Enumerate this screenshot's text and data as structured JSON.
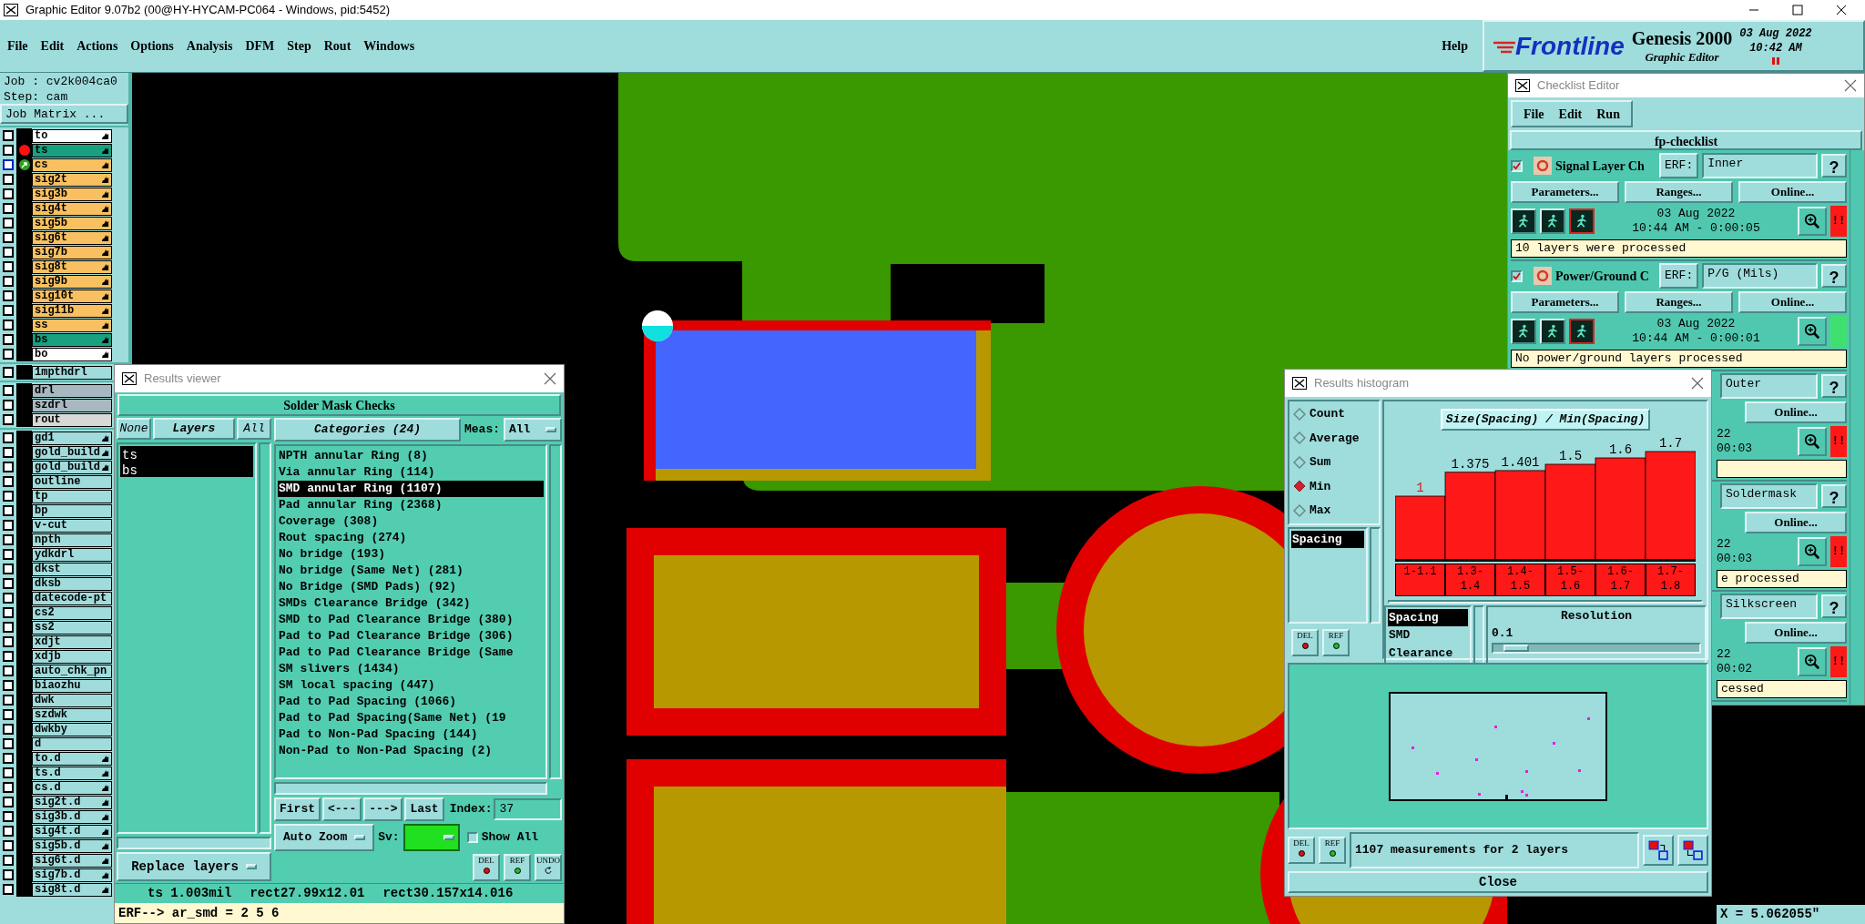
{
  "window": {
    "title": "Graphic Editor 9.07b2 (00@HY-HYCAM-PC064 - Windows, pid:5452)"
  },
  "menu": [
    "File",
    "Edit",
    "Actions",
    "Options",
    "Analysis",
    "DFM",
    "Step",
    "Rout",
    "Windows"
  ],
  "help": "Help",
  "logo": {
    "brand": "Frontline",
    "product": "Genesis 2000",
    "subtitle": "Graphic Editor",
    "date": "03 Aug 2022",
    "time": "10:42 AM"
  },
  "job": {
    "job": "Job : cv2k004ca0",
    "step": "Step: cam",
    "matrix_button": "Job Matrix ..."
  },
  "layer_groups": [
    [
      {
        "name": "to",
        "color": "#ffffff",
        "edit": true,
        "checked": false,
        "active": false,
        "affected": false
      },
      {
        "name": "ts",
        "color": "#18a080",
        "edit": true,
        "checked": false,
        "active": true,
        "affected": false
      },
      {
        "name": "cs",
        "color": "#f8c060",
        "edit": true,
        "checked": false,
        "active": false,
        "affected": true
      },
      {
        "name": "sig2t",
        "color": "#f8c060",
        "edit": true,
        "checked": false,
        "active": false,
        "affected": false
      },
      {
        "name": "sig3b",
        "color": "#f8c060",
        "edit": true,
        "checked": false,
        "active": false,
        "affected": false
      },
      {
        "name": "sig4t",
        "color": "#f8c060",
        "edit": true,
        "checked": false,
        "active": false,
        "affected": false
      },
      {
        "name": "sig5b",
        "color": "#f8c060",
        "edit": true,
        "checked": false,
        "active": false,
        "affected": false
      },
      {
        "name": "sig6t",
        "color": "#f8c060",
        "edit": true,
        "checked": false,
        "active": false,
        "affected": false
      },
      {
        "name": "sig7b",
        "color": "#f8c060",
        "edit": true,
        "checked": false,
        "active": false,
        "affected": false
      },
      {
        "name": "sig8t",
        "color": "#f8c060",
        "edit": true,
        "checked": false,
        "active": false,
        "affected": false
      },
      {
        "name": "sig9b",
        "color": "#f8c060",
        "edit": true,
        "checked": false,
        "active": false,
        "affected": false
      },
      {
        "name": "sig10t",
        "color": "#f8c060",
        "edit": true,
        "checked": false,
        "active": false,
        "affected": false
      },
      {
        "name": "sig11b",
        "color": "#f8c060",
        "edit": true,
        "checked": false,
        "active": false,
        "affected": false
      },
      {
        "name": "ss",
        "color": "#f8c060",
        "edit": true,
        "checked": false,
        "active": false,
        "affected": false
      },
      {
        "name": "bs",
        "color": "#18a080",
        "edit": true,
        "checked": false,
        "active": false,
        "affected": false
      },
      {
        "name": "bo",
        "color": "#ffffff",
        "edit": true,
        "checked": false,
        "active": false,
        "affected": false
      }
    ],
    [
      {
        "name": "1mpthdrl",
        "color": "#a0dcdc",
        "edit": false,
        "checked": false,
        "active": false,
        "affected": false
      }
    ],
    [
      {
        "name": "drl",
        "color": "#a8b8c0",
        "edit": false,
        "checked": false,
        "active": false,
        "affected": false
      },
      {
        "name": "szdrl",
        "color": "#a8b8c0",
        "edit": false,
        "checked": false,
        "active": false,
        "affected": false
      },
      {
        "name": "rout",
        "color": "#d8d8d8",
        "edit": false,
        "checked": false,
        "active": false,
        "affected": false
      }
    ],
    [
      {
        "name": "gd1",
        "color": "#a0dcdc",
        "edit": true,
        "checked": false,
        "active": false,
        "affected": false
      },
      {
        "name": "gold_build",
        "color": "#a0dcdc",
        "edit": true,
        "checked": false,
        "active": false,
        "affected": false
      },
      {
        "name": "gold_build",
        "color": "#a0dcdc",
        "edit": true,
        "checked": false,
        "active": false,
        "affected": false
      },
      {
        "name": "outline",
        "color": "#a0dcdc",
        "edit": false,
        "checked": false,
        "active": false,
        "affected": false
      },
      {
        "name": "tp",
        "color": "#a0dcdc",
        "edit": false,
        "checked": false,
        "active": false,
        "affected": false
      },
      {
        "name": "bp",
        "color": "#a0dcdc",
        "edit": false,
        "checked": false,
        "active": false,
        "affected": false
      },
      {
        "name": "v-cut",
        "color": "#a0dcdc",
        "edit": false,
        "checked": false,
        "active": false,
        "affected": false
      },
      {
        "name": "npth",
        "color": "#a0dcdc",
        "edit": false,
        "checked": false,
        "active": false,
        "affected": false
      },
      {
        "name": "ydkdrl",
        "color": "#a0dcdc",
        "edit": false,
        "checked": false,
        "active": false,
        "affected": false
      },
      {
        "name": "dkst",
        "color": "#a0dcdc",
        "edit": false,
        "checked": false,
        "active": false,
        "affected": false
      },
      {
        "name": "dksb",
        "color": "#a0dcdc",
        "edit": false,
        "checked": false,
        "active": false,
        "affected": false
      },
      {
        "name": "datecode-pt",
        "color": "#a0dcdc",
        "edit": false,
        "checked": false,
        "active": false,
        "affected": false
      },
      {
        "name": "cs2",
        "color": "#a0dcdc",
        "edit": false,
        "checked": false,
        "active": false,
        "affected": false
      },
      {
        "name": "ss2",
        "color": "#a0dcdc",
        "edit": false,
        "checked": false,
        "active": false,
        "affected": false
      },
      {
        "name": "xdjt",
        "color": "#a0dcdc",
        "edit": false,
        "checked": false,
        "active": false,
        "affected": false
      },
      {
        "name": "xdjb",
        "color": "#a0dcdc",
        "edit": false,
        "checked": false,
        "active": false,
        "affected": false
      },
      {
        "name": "auto_chk_pn",
        "color": "#a0dcdc",
        "edit": false,
        "checked": false,
        "active": false,
        "affected": false
      },
      {
        "name": "biaozhu",
        "color": "#a0dcdc",
        "edit": false,
        "checked": false,
        "active": false,
        "affected": false
      },
      {
        "name": "dwk",
        "color": "#a0dcdc",
        "edit": false,
        "checked": false,
        "active": false,
        "affected": false
      },
      {
        "name": "szdwk",
        "color": "#a0dcdc",
        "edit": false,
        "checked": false,
        "active": false,
        "affected": false
      },
      {
        "name": "dwkby",
        "color": "#a0dcdc",
        "edit": false,
        "checked": false,
        "active": false,
        "affected": false
      },
      {
        "name": "d",
        "color": "#a0dcdc",
        "edit": false,
        "checked": false,
        "active": false,
        "affected": false
      },
      {
        "name": "to.d",
        "color": "#a0dcdc",
        "edit": true,
        "checked": false,
        "active": false,
        "affected": false
      },
      {
        "name": "ts.d",
        "color": "#a0dcdc",
        "edit": true,
        "checked": false,
        "active": false,
        "affected": false
      },
      {
        "name": "cs.d",
        "color": "#a0dcdc",
        "edit": true,
        "checked": false,
        "active": false,
        "affected": false
      },
      {
        "name": "sig2t.d",
        "color": "#a0dcdc",
        "edit": true,
        "checked": false,
        "active": false,
        "affected": false
      },
      {
        "name": "sig3b.d",
        "color": "#a0dcdc",
        "edit": true,
        "checked": false,
        "active": false,
        "affected": false
      },
      {
        "name": "sig4t.d",
        "color": "#a0dcdc",
        "edit": true,
        "checked": false,
        "active": false,
        "affected": false
      },
      {
        "name": "sig5b.d",
        "color": "#a0dcdc",
        "edit": true,
        "checked": false,
        "active": false,
        "affected": false
      },
      {
        "name": "sig6t.d",
        "color": "#a0dcdc",
        "edit": true,
        "checked": false,
        "active": false,
        "affected": false
      },
      {
        "name": "sig7b.d",
        "color": "#a0dcdc",
        "edit": true,
        "checked": false,
        "active": false,
        "affected": false
      },
      {
        "name": "sig8t.d",
        "color": "#a0dcdc",
        "edit": true,
        "checked": false,
        "active": false,
        "affected": false
      }
    ]
  ],
  "checklist": {
    "title": "Checklist Editor",
    "menu": [
      "File",
      "Edit",
      "Run"
    ],
    "name": "fp-checklist",
    "checks": [
      {
        "kind": "full",
        "checked": true,
        "name": "Signal Layer Ch",
        "erf_label": "ERF:",
        "erf": "Inner",
        "help": "?",
        "buttons": [
          "Parameters...",
          "Ranges...",
          "Online..."
        ],
        "date": "03 Aug 2022",
        "time": "10:44 AM - 0:00:05",
        "alert": true,
        "status_text": "!!",
        "message": "10 layers were processed"
      },
      {
        "kind": "full",
        "checked": true,
        "name": "Power/Ground C",
        "erf_label": "ERF:",
        "erf": "P/G (Mils)",
        "help": "?",
        "buttons": [
          "Parameters...",
          "Ranges...",
          "Online..."
        ],
        "date": "03 Aug 2022",
        "time": "10:44 AM - 0:00:01",
        "alert": false,
        "message": "No power/ground layers processed"
      },
      {
        "kind": "partial",
        "erf": "Outer",
        "help": "?",
        "buttons": [
          "Online..."
        ],
        "date": "22",
        "time": "00:03",
        "alert": true,
        "status_text": "!!"
      },
      {
        "kind": "partial",
        "erf": "Soldermask",
        "help": "?",
        "buttons": [
          "Online..."
        ],
        "date": "22",
        "time": "00:03",
        "alert": true,
        "status_text": "!!",
        "message": "e processed"
      },
      {
        "kind": "partial",
        "erf": "Silkscreen",
        "help": "?",
        "buttons": [
          "Online..."
        ],
        "date": "22",
        "time": "00:02",
        "alert": true,
        "status_text": "!!",
        "message": "cessed"
      }
    ]
  },
  "coordinates": "X = 5.062055\"",
  "results_viewer": {
    "title": "Results viewer",
    "header": "Solder Mask Checks",
    "layer_buttons": [
      "None",
      "Layers",
      "All"
    ],
    "layers": [
      {
        "name": "ts",
        "selected": true
      },
      {
        "name": "bs",
        "selected": true
      }
    ],
    "categories_button": "Categories (24)",
    "meas_label": "Meas:",
    "meas_value": "All",
    "categories": [
      {
        "name": "NPTH annular Ring (8)",
        "selected": false
      },
      {
        "name": "Via annular Ring (114)",
        "selected": false
      },
      {
        "name": "SMD annular Ring (1107)",
        "selected": true
      },
      {
        "name": "Pad annular Ring (2368)",
        "selected": false
      },
      {
        "name": "Coverage (308)",
        "selected": false
      },
      {
        "name": "Rout spacing (274)",
        "selected": false
      },
      {
        "name": "No bridge (193)",
        "selected": false
      },
      {
        "name": "No bridge (Same Net) (281)",
        "selected": false
      },
      {
        "name": "No Bridge (SMD Pads) (92)",
        "selected": false
      },
      {
        "name": "SMDs Clearance Bridge (342)",
        "selected": false
      },
      {
        "name": "SMD to Pad Clearance Bridge (380)",
        "selected": false
      },
      {
        "name": "Pad to Pad Clearance Bridge (306)",
        "selected": false
      },
      {
        "name": "Pad to Pad Clearance Bridge (Same",
        "selected": false
      },
      {
        "name": "SM slivers (1434)",
        "selected": false
      },
      {
        "name": "SM local spacing (447)",
        "selected": false
      },
      {
        "name": "Pad to Pad Spacing (1066)",
        "selected": false
      },
      {
        "name": "Pad to Pad Spacing(Same Net) (19",
        "selected": false
      },
      {
        "name": "Pad to Non-Pad Spacing (144)",
        "selected": false
      },
      {
        "name": "Non-Pad to Non-Pad Spacing (2)",
        "selected": false
      }
    ],
    "nav": [
      "First",
      "<---",
      "--->",
      "Last"
    ],
    "index_label": "Index:",
    "index": "37",
    "auto_zoom": "Auto Zoom",
    "sv_label": "Sv:",
    "show_all": {
      "label": "Show All",
      "checked": false
    },
    "replace": "Replace layers",
    "actions": [
      "DEL",
      "REF",
      "UNDO"
    ],
    "status": [
      "ts 1.003mil",
      "rect27.99x12.01",
      "rect30.157x14.016"
    ],
    "erf_line": "ERF--> ar_smd = 2 5 6"
  },
  "histogram": {
    "title": "Results histogram",
    "modes": [
      {
        "label": "Count",
        "selected": false
      },
      {
        "label": "Average",
        "selected": false
      },
      {
        "label": "Sum",
        "selected": false
      },
      {
        "label": "Min",
        "selected": true
      },
      {
        "label": "Max",
        "selected": false
      }
    ],
    "measures": [
      {
        "label": "Spacing",
        "selected": true
      }
    ],
    "small_actions": [
      "DEL",
      "REF"
    ],
    "chart_data": {
      "type": "bar",
      "title": "Size(Spacing) / Min(Spacing)",
      "categories": [
        "1-1.1",
        "1.3-1.4",
        "1.4-1.5",
        "1.5-1.6",
        "1.6-1.7",
        "1.7-1.8"
      ],
      "values": [
        1,
        1.375,
        1.401,
        1.5,
        1.6,
        1.7
      ],
      "data_labels": true
    },
    "types": [
      {
        "label": "Spacing",
        "selected": true
      },
      {
        "label": "SMD",
        "selected": false
      },
      {
        "label": "Clearance",
        "selected": false
      }
    ],
    "resolution": {
      "label": "Resolution",
      "value": "0.1",
      "level": 0.05
    },
    "actions": [
      "DEL",
      "REF"
    ],
    "summary": "1107 measurements for 2 layers",
    "close": "Close"
  }
}
